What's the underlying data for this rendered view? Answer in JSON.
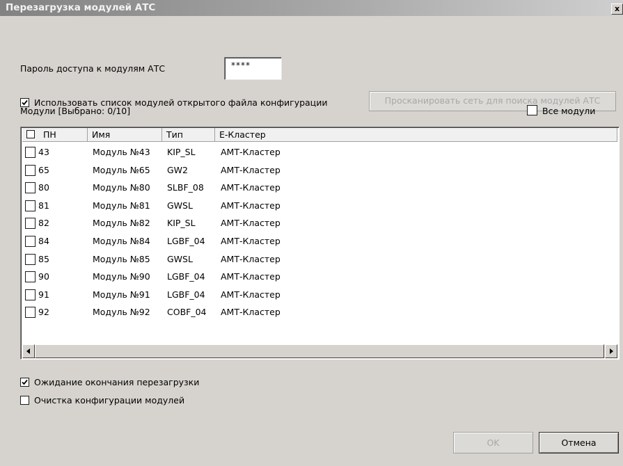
{
  "window": {
    "title": "Перезагрузка модулей АТС",
    "close_label": "x"
  },
  "password": {
    "label": "Пароль доступа к модулям АТС",
    "value": "****"
  },
  "use_config_list": {
    "label": "Использовать список модулей открытого файла конфигурации",
    "checked": true
  },
  "scan_button_label": "Просканировать сеть для поиска модулей АТС",
  "modules_caption": "Модули [Выбрано: 0/10]",
  "all_modules": {
    "label": "Все модули",
    "checked": false
  },
  "table": {
    "columns": [
      "ПН",
      "Имя",
      "Тип",
      "Е-Кластер"
    ],
    "rows": [
      {
        "pn": "43",
        "name": "Модуль №43",
        "type": "KIP_SL",
        "cluster": "АМТ-Кластер",
        "checked": false
      },
      {
        "pn": "65",
        "name": "Модуль №65",
        "type": "GW2",
        "cluster": "АМТ-Кластер",
        "checked": false
      },
      {
        "pn": "80",
        "name": "Модуль №80",
        "type": "SLBF_08",
        "cluster": "АМТ-Кластер",
        "checked": false
      },
      {
        "pn": "81",
        "name": "Модуль №81",
        "type": "GWSL",
        "cluster": "АМТ-Кластер",
        "checked": false
      },
      {
        "pn": "82",
        "name": "Модуль №82",
        "type": "KIP_SL",
        "cluster": "АМТ-Кластер",
        "checked": false
      },
      {
        "pn": "84",
        "name": "Модуль №84",
        "type": "LGBF_04",
        "cluster": "АМТ-Кластер",
        "checked": false
      },
      {
        "pn": "85",
        "name": "Модуль №85",
        "type": "GWSL",
        "cluster": "АМТ-Кластер",
        "checked": false
      },
      {
        "pn": "90",
        "name": "Модуль №90",
        "type": "LGBF_04",
        "cluster": "АМТ-Кластер",
        "checked": false
      },
      {
        "pn": "91",
        "name": "Модуль №91",
        "type": "LGBF_04",
        "cluster": "АМТ-Кластер",
        "checked": false
      },
      {
        "pn": "92",
        "name": "Модуль №92",
        "type": "COBF_04",
        "cluster": "АМТ-Кластер",
        "checked": false
      }
    ]
  },
  "wait_reboot": {
    "label": "Ожидание окончания перезагрузки",
    "checked": true
  },
  "clear_config": {
    "label": "Очистка конфигурации модулей",
    "checked": false
  },
  "ok_label": "OK",
  "cancel_label": "Отмена"
}
